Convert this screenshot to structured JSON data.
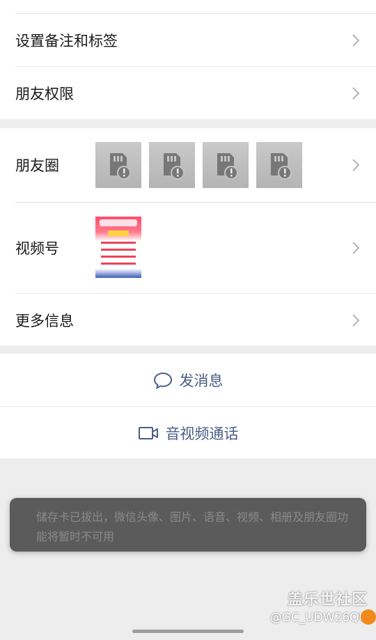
{
  "group1": {
    "items": [
      {
        "label": "设置备注和标签"
      },
      {
        "label": "朋友权限"
      }
    ]
  },
  "group2": {
    "moments_label": "朋友圈",
    "channels_label": "视频号",
    "more_label": "更多信息",
    "moments_thumbnail_icon": "sd-card-alert-icon"
  },
  "actions": {
    "message_label": "发消息",
    "message_icon": "chat-bubble-icon",
    "call_label": "音视频通话",
    "call_icon": "video-camera-icon"
  },
  "toast": {
    "text": "储存卡已拔出，微信头像、图片、语音、视频、相册及朋友圈功能将暂时不可用"
  },
  "watermark": {
    "line1": "盖乐世社区",
    "line2": "@GC_UDW26QU"
  },
  "colors": {
    "accent_link": "#4a5d85",
    "background": "#ededed",
    "toast_bg": "#5b5b5b"
  }
}
